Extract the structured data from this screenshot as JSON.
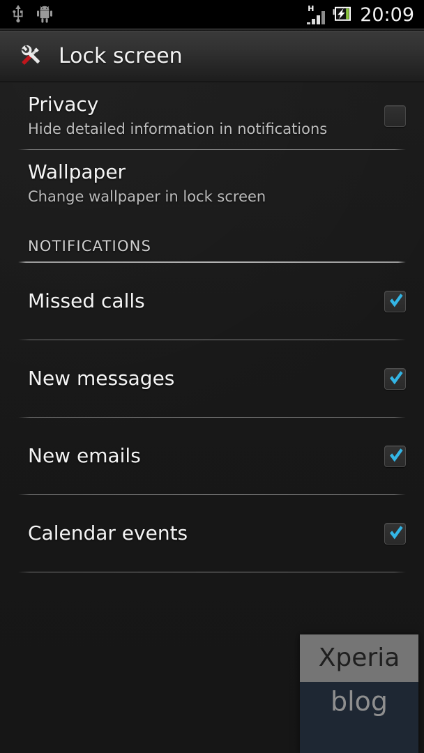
{
  "status_bar": {
    "left_icons": [
      {
        "name": "usb-icon",
        "label": "USB connected"
      },
      {
        "name": "android-icon",
        "label": "Android system notification"
      }
    ],
    "network_type": "H",
    "signal_bars_filled": 3,
    "signal_bars_total": 4,
    "battery": {
      "name": "battery-charging-icon",
      "charging": true,
      "fill_color": "#8cc63f"
    },
    "time": "20:09"
  },
  "title_bar": {
    "icon": "settings-tools-icon",
    "title": "Lock screen"
  },
  "settings": {
    "items": [
      {
        "name": "privacy",
        "title": "Privacy",
        "summary": "Hide detailed information in notifications",
        "has_checkbox": true,
        "checked": false
      },
      {
        "name": "wallpaper",
        "title": "Wallpaper",
        "summary": "Change wallpaper in lock screen",
        "has_checkbox": false,
        "checked": false
      }
    ],
    "section_header": "NOTIFICATIONS",
    "notifications": [
      {
        "name": "missed-calls",
        "title": "Missed calls",
        "checked": true
      },
      {
        "name": "new-messages",
        "title": "New messages",
        "checked": true
      },
      {
        "name": "new-emails",
        "title": "New emails",
        "checked": true
      },
      {
        "name": "calendar-events",
        "title": "Calendar events",
        "checked": true
      }
    ]
  },
  "watermark": {
    "top_text": "Xperia",
    "bottom_text": "blog",
    "top_bg": "#757575",
    "bottom_bg": "#1e2733"
  },
  "colors": {
    "accent_check": "#33b5e5",
    "background": "#1a1a1a",
    "title_text": "#f4f4f4",
    "summary_text": "#bdbdbd"
  }
}
